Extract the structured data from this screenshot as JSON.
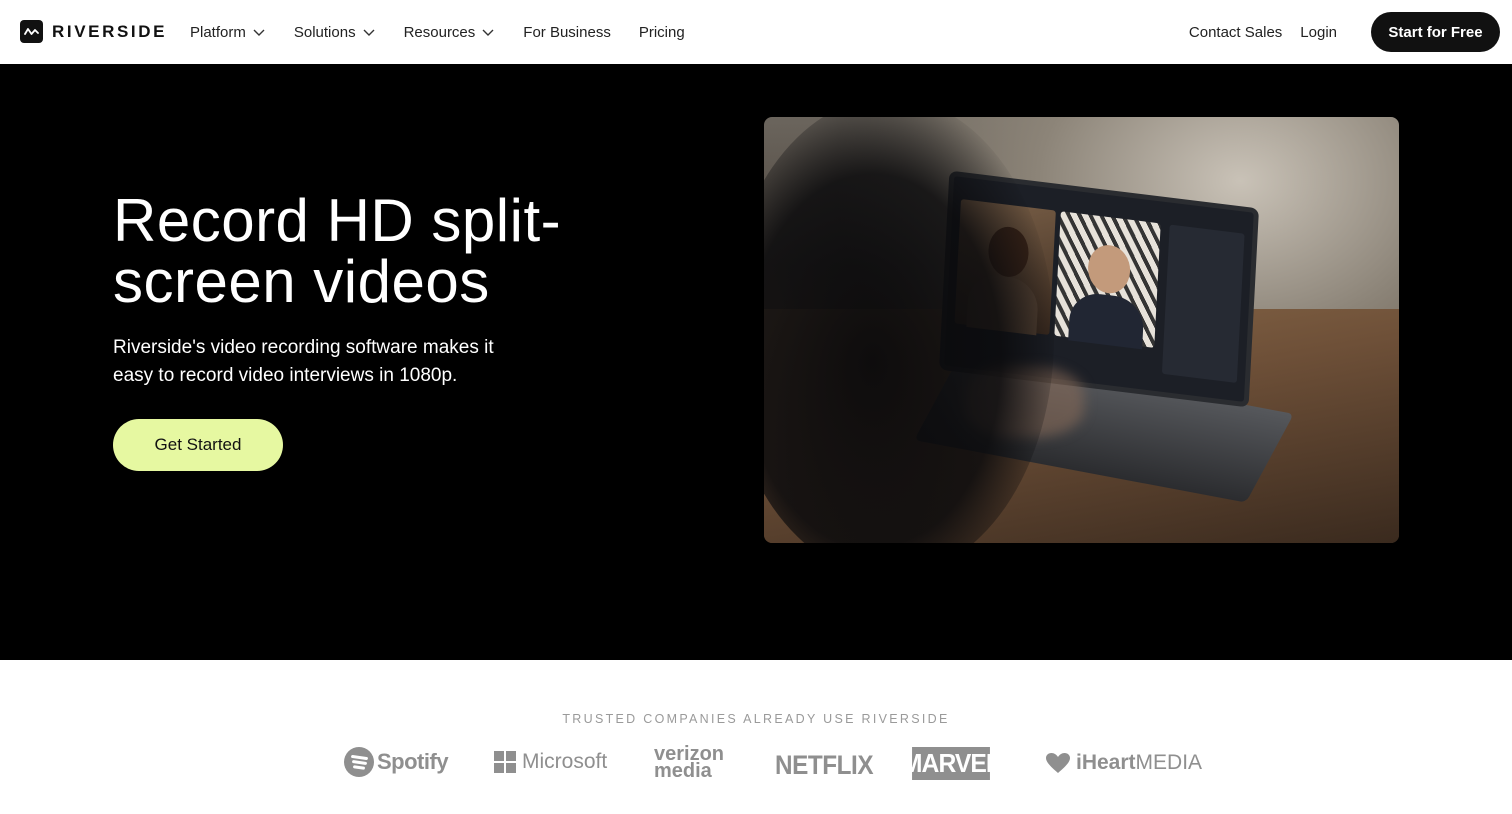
{
  "nav": {
    "logo_text": "RIVERSIDE",
    "items": [
      {
        "label": "Platform",
        "dropdown": true
      },
      {
        "label": "Solutions",
        "dropdown": true
      },
      {
        "label": "Resources",
        "dropdown": true
      },
      {
        "label": "For Business",
        "dropdown": false
      },
      {
        "label": "Pricing",
        "dropdown": false
      }
    ],
    "contact_sales": "Contact Sales",
    "login": "Login",
    "cta": "Start for Free"
  },
  "hero": {
    "title": "Record HD split-screen videos",
    "subtitle": "Riverside's video recording software makes it easy to record video interviews in 1080p.",
    "cta": "Get Started",
    "image": "laptop-video-call-photo"
  },
  "trusted": {
    "heading": "TRUSTED COMPANIES ALREADY USE RIVERSIDE",
    "logos": [
      {
        "name": "Spotify",
        "text": "Spotify"
      },
      {
        "name": "Microsoft",
        "text": "Microsoft"
      },
      {
        "name": "Verizon Media",
        "text_top": "verizon",
        "text_bottom": "media"
      },
      {
        "name": "Netflix",
        "text": "NETFLIX"
      },
      {
        "name": "Marvel",
        "text": "MARVEL"
      },
      {
        "name": "iHeartMedia",
        "text_bold": "iHeart",
        "text_light": "MEDIA"
      }
    ]
  },
  "colors": {
    "hero_bg": "#000000",
    "accent_cta": "#e6f8a1",
    "dark_button": "#111111",
    "logo_gray": "#8f8f8f"
  }
}
